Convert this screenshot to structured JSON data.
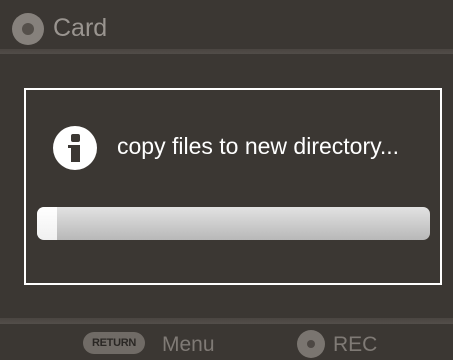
{
  "header": {
    "title": "Card",
    "icon": "card-slot-icon"
  },
  "dialog": {
    "icon": "info-icon",
    "message": "copy files to new directory...",
    "progress_fraction": 0.05
  },
  "footer": {
    "return_label": "RETURN",
    "menu_label": "Menu",
    "rec_icon": "record-icon",
    "rec_label": "REC"
  },
  "colors": {
    "background": "#3b3733",
    "dialog_border": "#ffffff",
    "progress_track": "#c8c8c8",
    "progress_fill": "#ffffff",
    "footer_text": "#7f7a75"
  }
}
